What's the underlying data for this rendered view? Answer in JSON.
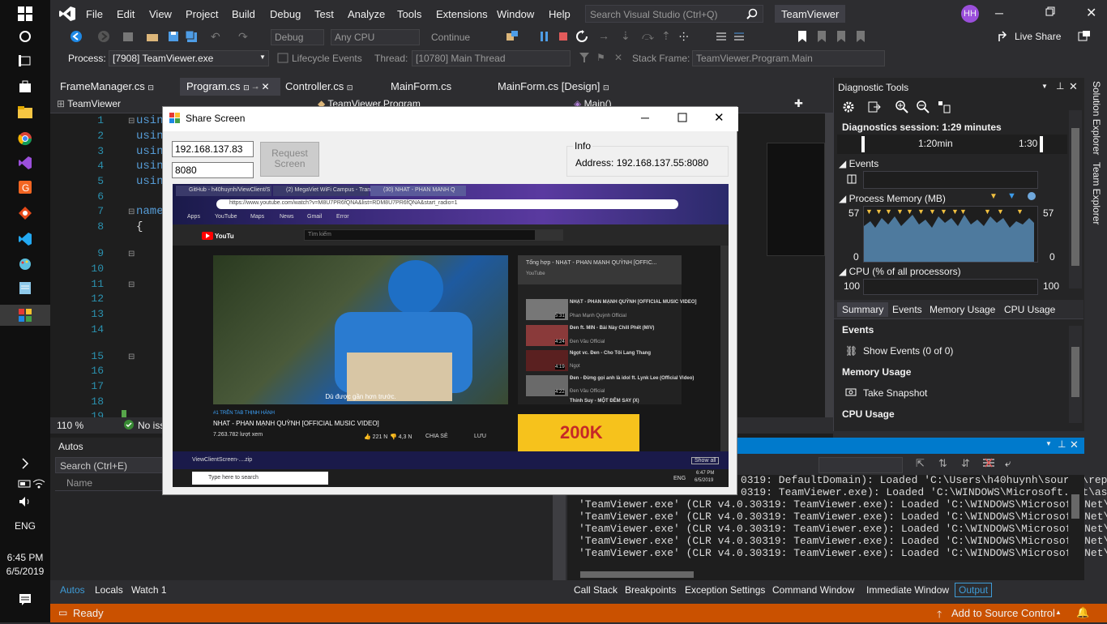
{
  "taskbar": {
    "clock_time": "6:45 PM",
    "clock_date": "6/5/2019",
    "lang": "ENG"
  },
  "menu": [
    "File",
    "Edit",
    "View",
    "Project",
    "Build",
    "Debug",
    "Test",
    "Analyze",
    "Tools",
    "Extensions",
    "Window",
    "Help"
  ],
  "search": {
    "placeholder": "Search Visual Studio (Ctrl+Q)"
  },
  "solution_name": "TeamViewer",
  "user_initials": "HH",
  "toolbar": {
    "config": "Debug",
    "platform": "Any CPU",
    "continue": "Continue",
    "live_share": "Live Share",
    "process_label": "Process:",
    "process_value": "[7908] TeamViewer.exe",
    "lifecycle": "Lifecycle Events",
    "thread_label": "Thread:",
    "thread_value": "[10780] Main Thread",
    "stackframe_label": "Stack Frame:",
    "stackframe_value": "TeamViewer.Program.Main"
  },
  "doc_tabs": [
    "FrameManager.cs",
    "Program.cs",
    "Controller.cs",
    "MainForm.cs",
    "MainForm.cs [Design]"
  ],
  "nav_bar": {
    "project": "TeamViewer",
    "class": "TeamViewer.Program",
    "member": "Main()"
  },
  "editor": {
    "line_numbers": [
      "1",
      "2",
      "3",
      "4",
      "5",
      "6",
      "7",
      "8",
      "9",
      "10",
      "11",
      "12",
      "13",
      "14",
      "15",
      "16",
      "17",
      "18",
      "19"
    ],
    "code_fragments": [
      "usin",
      "usin",
      "usin",
      "usin",
      "usin",
      "name",
      "{"
    ],
    "zoom": "110 %",
    "issues": "No iss"
  },
  "diag": {
    "title": "Diagnostic Tools",
    "session": "Diagnostics session: 1:29 minutes",
    "time1": "1:20min",
    "time2": "1:30",
    "events_label": "Events",
    "memory_label": "Process Memory (MB)",
    "mem_max": "57",
    "mem_min": "0",
    "cpu_label": "CPU (% of all processors)",
    "cpu_max": "100",
    "tabs": [
      "Summary",
      "Events",
      "Memory Usage",
      "CPU Usage"
    ],
    "sec_events": "Events",
    "show_events": "Show Events (0 of 0)",
    "sec_memory": "Memory Usage",
    "take_snapshot": "Take Snapshot",
    "sec_cpu": "CPU Usage"
  },
  "right_strip": [
    "Solution Explorer",
    "Team Explorer"
  ],
  "autos": {
    "title": "Autos",
    "search": "Search (Ctrl+E)",
    "col_name": "Name",
    "tabs": [
      "Autos",
      "Locals",
      "Watch 1"
    ]
  },
  "output": {
    "lines": [
      "0319: DefaultDomain): Loaded  'C:\\Users\\h40huynh\\source\\rep",
      "0319: TeamViewer.exe): Loaded 'C:\\WINDOWS\\Microsoft.Net\\as",
      "'TeamViewer.exe' (CLR v4.0.30319: TeamViewer.exe): Loaded 'C:\\WINDOWS\\Microsoft.Net\\as",
      "'TeamViewer.exe' (CLR v4.0.30319: TeamViewer.exe): Loaded 'C:\\WINDOWS\\Microsoft.Net\\as",
      "'TeamViewer.exe' (CLR v4.0.30319: TeamViewer.exe): Loaded 'C:\\WINDOWS\\Microsoft.Net\\as",
      "'TeamViewer.exe' (CLR v4.0.30319: TeamViewer.exe): Loaded 'C:\\WINDOWS\\Microsoft.Net\\as",
      "'TeamViewer.exe' (CLR v4.0.30319: TeamViewer.exe): Loaded 'C:\\WINDOWS\\Microsoft.Net\\as"
    ],
    "tabs": [
      "Call Stack",
      "Breakpoints",
      "Exception Settings",
      "Command Window",
      "Immediate Window",
      "Output"
    ]
  },
  "status": {
    "ready": "Ready",
    "source_control": "Add to Source Control"
  },
  "dialog": {
    "title": "Share Screen",
    "ip": "192.168.137.83",
    "port": "8080",
    "request_btn": "Request Screen",
    "info_title": "Info",
    "info_text": "Address: 192.168.137.55:8080"
  },
  "remote": {
    "tabs": [
      "GitHub - h40huynh/ViewClient/S",
      "(2) MegaViet WiFi Campus - Tran",
      "(30) NHAT - PHAN MANH Q"
    ],
    "url": "https://www.youtube.com/watch?v=M8U7PR6fQNA&list=RDM8U7PR6fQNA&start_radio=1",
    "bookmarks": [
      "Apps",
      "YouTube",
      "Maps",
      "News",
      "Gmail",
      "Error"
    ],
    "yt_search": "Tìm kiếm",
    "subtitle": "Dù được gần hơn trước.",
    "trending": "#1 TRÊN TAB THỊNH HÀNH",
    "video_title": "NHAT - PHAN MẠNH QUỲNH [OFFICIAL MUSIC VIDEO]",
    "views": "7.263.782 lượt xem",
    "likes": "221 N",
    "dislikes": "4,3 N",
    "share": "CHIA SẺ",
    "save": "LƯU",
    "playlist_title": "Tổng hợp - NHẠT - PHAN MẠNH QUỲNH [OFFIC...",
    "playlist_sub": "YouTube",
    "items": [
      {
        "title": "NHẠT - PHAN MẠNH QUỲNH [OFFICIAL MUSIC VIDEO]",
        "channel": "Phan Mạnh Quỳnh Official",
        "dur": "5:31"
      },
      {
        "title": "Đen ft. MIN - Bài Này Chill Phết (M/V)",
        "channel": "Đen Vâu Official",
        "dur": "4:24"
      },
      {
        "title": "Ngọt vc. Đen - Cho Tôi Lang Thang",
        "channel": "Ngọt",
        "dur": "4:19"
      },
      {
        "title": "Đen - Đừng gọi anh là idol ft. Lynk Lee (Official Video)",
        "channel": "Đen Vâu Official",
        "dur": "4:22"
      },
      {
        "title": "Thinh Suy - MỘT ĐÊM SAY (X)",
        "channel": "",
        "dur": ""
      }
    ],
    "ad_text": "200K",
    "download_file": "ViewClientScreen-....zip",
    "show_all": "Show all",
    "win_search": "Type here to search",
    "win_time": "6:47 PM",
    "win_date": "6/5/2019",
    "win_lang": "ENG"
  },
  "colors": {
    "accent": "#007acc",
    "status": "#ca5100",
    "vs_purple": "#9b4fdb"
  }
}
